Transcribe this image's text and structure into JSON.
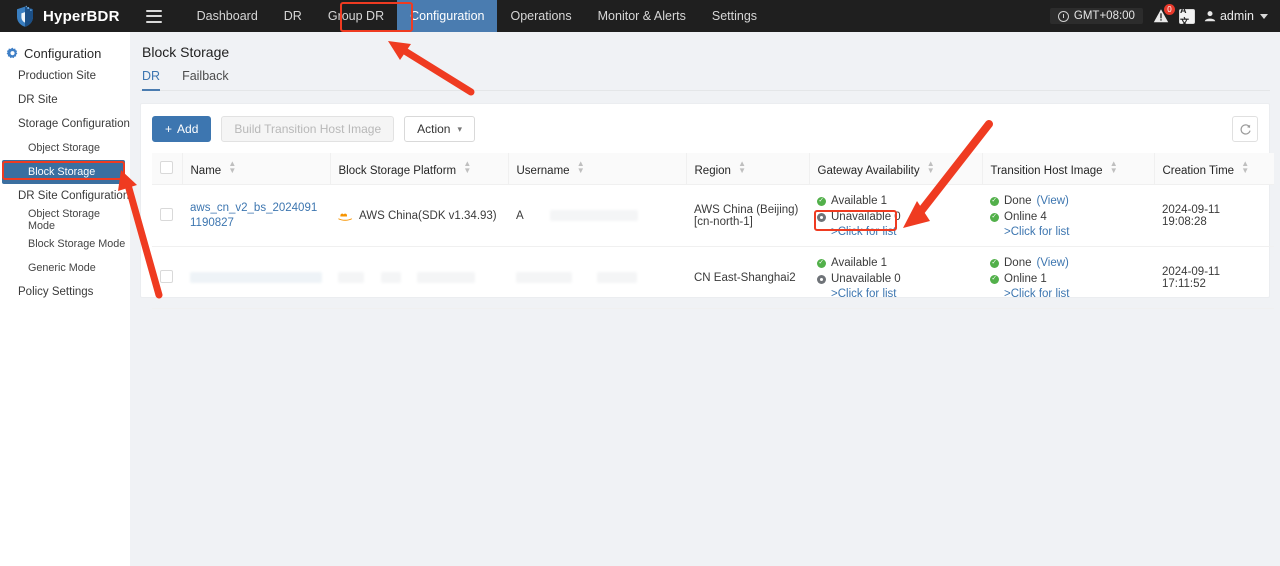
{
  "topnav": {
    "brand": "HyperBDR",
    "menu_icon": "hamburger-icon",
    "items": [
      {
        "label": "Dashboard",
        "active": false
      },
      {
        "label": "DR",
        "active": false
      },
      {
        "label": "Group DR",
        "active": false
      },
      {
        "label": "Configuration",
        "active": true
      },
      {
        "label": "Operations",
        "active": false
      },
      {
        "label": "Monitor & Alerts",
        "active": false
      },
      {
        "label": "Settings",
        "active": false
      }
    ],
    "timezone": "GMT+08:00",
    "alert_badge": "0",
    "lang_icon_label": "A文",
    "user": "admin"
  },
  "sidebar": {
    "title": "Configuration",
    "items": [
      {
        "label": "Production Site",
        "level": 1,
        "selected": false
      },
      {
        "label": "DR Site",
        "level": 1,
        "selected": false
      },
      {
        "label": "Storage Configuration",
        "level": 1,
        "selected": false
      },
      {
        "label": "Object Storage",
        "level": 2,
        "selected": false
      },
      {
        "label": "Block Storage",
        "level": 2,
        "selected": true
      },
      {
        "label": "DR Site Configuration",
        "level": 1,
        "selected": false
      },
      {
        "label": "Object Storage Mode",
        "level": 2,
        "selected": false
      },
      {
        "label": "Block Storage Mode",
        "level": 2,
        "selected": false
      },
      {
        "label": "Generic Mode",
        "level": 2,
        "selected": false
      },
      {
        "label": "Policy Settings",
        "level": 1,
        "selected": false
      }
    ]
  },
  "page": {
    "title": "Block Storage",
    "tabs": [
      {
        "label": "DR",
        "active": true
      },
      {
        "label": "Failback",
        "active": false
      }
    ]
  },
  "toolbar": {
    "add_label": "Add",
    "build_image_label": "Build Transition Host Image",
    "action_label": "Action",
    "action_caret": "⌄",
    "refresh_icon": "refresh-icon"
  },
  "table": {
    "columns": [
      "Name",
      "Block Storage Platform",
      "Username",
      "Region",
      "Gateway Availability",
      "Transition Host Image",
      "Creation Time"
    ],
    "rows": [
      {
        "name": "aws_cn_v2_bs_20240911190827",
        "redacted": false,
        "platform": "AWS China(SDK v1.34.93)",
        "platform_icon": "aws-icon",
        "username": "A",
        "region": "AWS China (Beijing)[cn-north-1]",
        "gateway": {
          "available_label": "Available 1",
          "unavailable_label": "Unavailable 0",
          "link": ">Click for list"
        },
        "transition": {
          "done_label": "Done",
          "view_label": "(View)",
          "online_label": "Online 4",
          "link": ">Click for list"
        },
        "creation_time": "2024-09-11 19:08:28"
      },
      {
        "name": "",
        "redacted": true,
        "platform": "",
        "platform_icon": "",
        "username": "",
        "region": "CN East-Shanghai2",
        "gateway": {
          "available_label": "Available 1",
          "unavailable_label": "Unavailable 0",
          "link": ">Click for list"
        },
        "transition": {
          "done_label": "Done",
          "view_label": "(View)",
          "online_label": "Online 1",
          "link": ">Click for list"
        },
        "creation_time": "2024-09-11 17:11:52"
      }
    ]
  },
  "annotations": {
    "accent_color": "#ef3b21",
    "highlights": [
      {
        "target": "nav-configuration"
      },
      {
        "target": "sidebar-block-storage"
      },
      {
        "target": "row1-gateway-click-for-list"
      }
    ],
    "arrows": [
      {
        "points_to": "nav-configuration"
      },
      {
        "points_to": "sidebar-block-storage"
      },
      {
        "points_to": "row1-gateway-click-for-list"
      }
    ]
  }
}
